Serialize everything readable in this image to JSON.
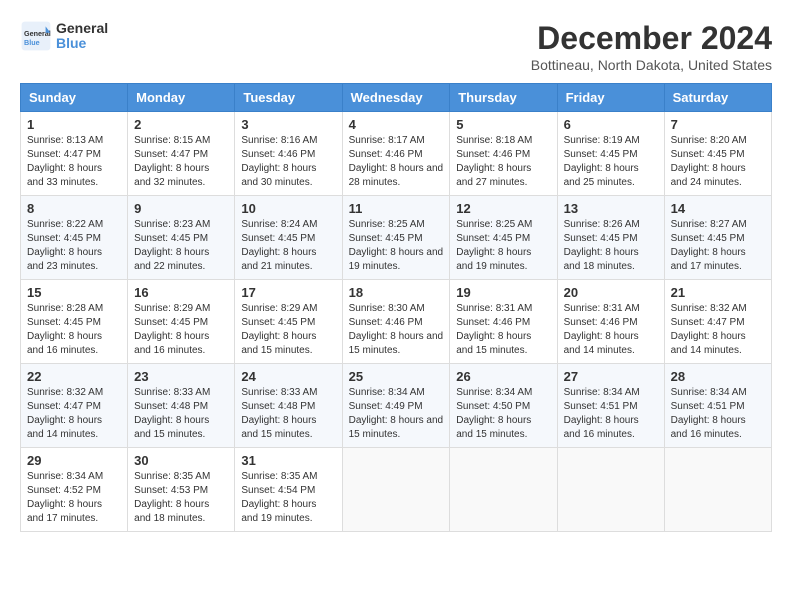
{
  "logo": {
    "line1": "General",
    "line2": "Blue"
  },
  "title": "December 2024",
  "subtitle": "Bottineau, North Dakota, United States",
  "days_of_week": [
    "Sunday",
    "Monday",
    "Tuesday",
    "Wednesday",
    "Thursday",
    "Friday",
    "Saturday"
  ],
  "weeks": [
    [
      {
        "day": "1",
        "sunrise": "8:13 AM",
        "sunset": "4:47 PM",
        "daylight": "8 hours and 33 minutes."
      },
      {
        "day": "2",
        "sunrise": "8:15 AM",
        "sunset": "4:47 PM",
        "daylight": "8 hours and 32 minutes."
      },
      {
        "day": "3",
        "sunrise": "8:16 AM",
        "sunset": "4:46 PM",
        "daylight": "8 hours and 30 minutes."
      },
      {
        "day": "4",
        "sunrise": "8:17 AM",
        "sunset": "4:46 PM",
        "daylight": "8 hours and 28 minutes."
      },
      {
        "day": "5",
        "sunrise": "8:18 AM",
        "sunset": "4:46 PM",
        "daylight": "8 hours and 27 minutes."
      },
      {
        "day": "6",
        "sunrise": "8:19 AM",
        "sunset": "4:45 PM",
        "daylight": "8 hours and 25 minutes."
      },
      {
        "day": "7",
        "sunrise": "8:20 AM",
        "sunset": "4:45 PM",
        "daylight": "8 hours and 24 minutes."
      }
    ],
    [
      {
        "day": "8",
        "sunrise": "8:22 AM",
        "sunset": "4:45 PM",
        "daylight": "8 hours and 23 minutes."
      },
      {
        "day": "9",
        "sunrise": "8:23 AM",
        "sunset": "4:45 PM",
        "daylight": "8 hours and 22 minutes."
      },
      {
        "day": "10",
        "sunrise": "8:24 AM",
        "sunset": "4:45 PM",
        "daylight": "8 hours and 21 minutes."
      },
      {
        "day": "11",
        "sunrise": "8:25 AM",
        "sunset": "4:45 PM",
        "daylight": "8 hours and 19 minutes."
      },
      {
        "day": "12",
        "sunrise": "8:25 AM",
        "sunset": "4:45 PM",
        "daylight": "8 hours and 19 minutes."
      },
      {
        "day": "13",
        "sunrise": "8:26 AM",
        "sunset": "4:45 PM",
        "daylight": "8 hours and 18 minutes."
      },
      {
        "day": "14",
        "sunrise": "8:27 AM",
        "sunset": "4:45 PM",
        "daylight": "8 hours and 17 minutes."
      }
    ],
    [
      {
        "day": "15",
        "sunrise": "8:28 AM",
        "sunset": "4:45 PM",
        "daylight": "8 hours and 16 minutes."
      },
      {
        "day": "16",
        "sunrise": "8:29 AM",
        "sunset": "4:45 PM",
        "daylight": "8 hours and 16 minutes."
      },
      {
        "day": "17",
        "sunrise": "8:29 AM",
        "sunset": "4:45 PM",
        "daylight": "8 hours and 15 minutes."
      },
      {
        "day": "18",
        "sunrise": "8:30 AM",
        "sunset": "4:46 PM",
        "daylight": "8 hours and 15 minutes."
      },
      {
        "day": "19",
        "sunrise": "8:31 AM",
        "sunset": "4:46 PM",
        "daylight": "8 hours and 15 minutes."
      },
      {
        "day": "20",
        "sunrise": "8:31 AM",
        "sunset": "4:46 PM",
        "daylight": "8 hours and 14 minutes."
      },
      {
        "day": "21",
        "sunrise": "8:32 AM",
        "sunset": "4:47 PM",
        "daylight": "8 hours and 14 minutes."
      }
    ],
    [
      {
        "day": "22",
        "sunrise": "8:32 AM",
        "sunset": "4:47 PM",
        "daylight": "8 hours and 14 minutes."
      },
      {
        "day": "23",
        "sunrise": "8:33 AM",
        "sunset": "4:48 PM",
        "daylight": "8 hours and 15 minutes."
      },
      {
        "day": "24",
        "sunrise": "8:33 AM",
        "sunset": "4:48 PM",
        "daylight": "8 hours and 15 minutes."
      },
      {
        "day": "25",
        "sunrise": "8:34 AM",
        "sunset": "4:49 PM",
        "daylight": "8 hours and 15 minutes."
      },
      {
        "day": "26",
        "sunrise": "8:34 AM",
        "sunset": "4:50 PM",
        "daylight": "8 hours and 15 minutes."
      },
      {
        "day": "27",
        "sunrise": "8:34 AM",
        "sunset": "4:51 PM",
        "daylight": "8 hours and 16 minutes."
      },
      {
        "day": "28",
        "sunrise": "8:34 AM",
        "sunset": "4:51 PM",
        "daylight": "8 hours and 16 minutes."
      }
    ],
    [
      {
        "day": "29",
        "sunrise": "8:34 AM",
        "sunset": "4:52 PM",
        "daylight": "8 hours and 17 minutes."
      },
      {
        "day": "30",
        "sunrise": "8:35 AM",
        "sunset": "4:53 PM",
        "daylight": "8 hours and 18 minutes."
      },
      {
        "day": "31",
        "sunrise": "8:35 AM",
        "sunset": "4:54 PM",
        "daylight": "8 hours and 19 minutes."
      },
      null,
      null,
      null,
      null
    ]
  ],
  "labels": {
    "sunrise": "Sunrise:",
    "sunset": "Sunset:",
    "daylight": "Daylight:"
  }
}
